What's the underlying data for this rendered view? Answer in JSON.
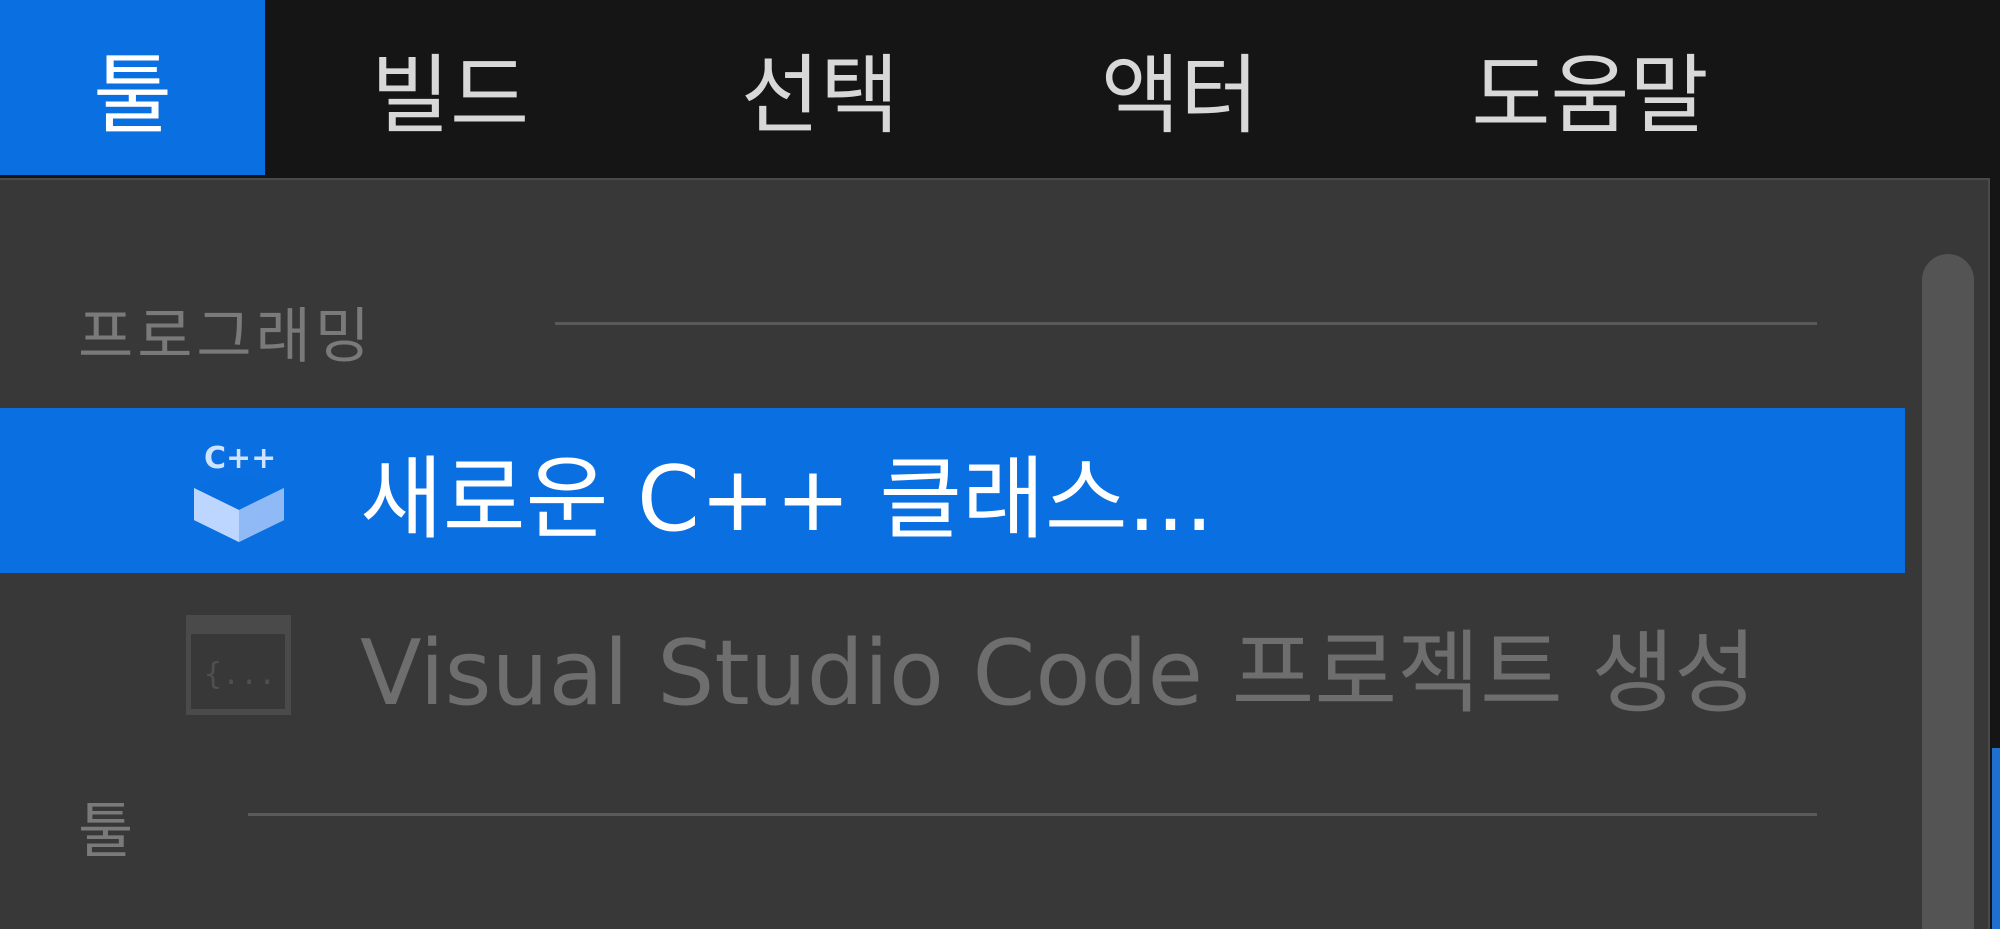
{
  "menubar": {
    "items": [
      {
        "label": "툴",
        "active": true
      },
      {
        "label": "빌드",
        "active": false
      },
      {
        "label": "선택",
        "active": false
      },
      {
        "label": "액터",
        "active": false
      },
      {
        "label": "도움말",
        "active": false
      }
    ]
  },
  "dropdown": {
    "sections": [
      {
        "title": "프로그래밍",
        "items": [
          {
            "label": "새로운 C++ 클래스...",
            "icon": "cpp-class-icon",
            "highlighted": true,
            "enabled": true
          },
          {
            "label": "Visual Studio Code 프로젝트 생성",
            "icon": "code-project-icon",
            "highlighted": false,
            "enabled": false
          }
        ]
      },
      {
        "title": "툴",
        "items": []
      }
    ]
  },
  "colors": {
    "accent": "#0a6fe0",
    "menubar_bg": "#151515",
    "dropdown_bg": "#383838",
    "disabled_text": "#6e6e6e",
    "section_text": "#7a7a7a"
  }
}
